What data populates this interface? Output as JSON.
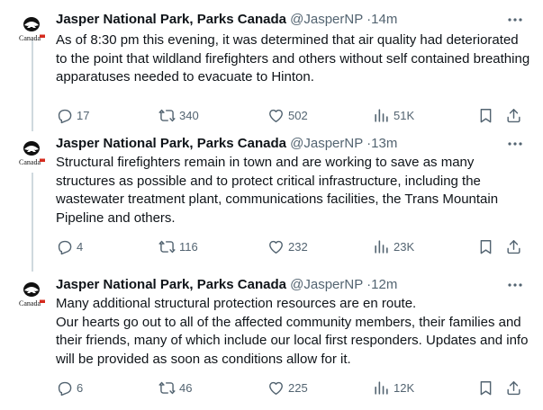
{
  "thread": [
    {
      "author": {
        "name": "Jasper National Park, Parks Canada",
        "handle": "@JasperNP",
        "time": "14m",
        "avatar_label": "Canada"
      },
      "text": [
        "As of  8:30 pm this evening, it was determined that air quality had deteriorated to the point that wildland firefighters and others without self contained breathing apparatuses needed to evacuate to Hinton."
      ],
      "stats": {
        "replies": "17",
        "reposts": "340",
        "likes": "502",
        "views": "51K"
      }
    },
    {
      "author": {
        "name": "Jasper National Park, Parks Canada",
        "handle": "@JasperNP",
        "time": "13m",
        "avatar_label": "Canada"
      },
      "text": [
        "Structural firefighters remain in town and are working to save as many structures as possible and to protect critical infrastructure, including the wastewater treatment plant, communications facilities, the Trans Mountain Pipeline and others."
      ],
      "stats": {
        "replies": "4",
        "reposts": "116",
        "likes": "232",
        "views": "23K"
      }
    },
    {
      "author": {
        "name": "Jasper National Park, Parks Canada",
        "handle": "@JasperNP",
        "time": "12m",
        "avatar_label": "Canada"
      },
      "text": [
        "Many additional structural protection resources are en route.",
        "Our hearts go out to all of the affected community members, their families and their friends, many of which include our local first responders. Updates and info will be provided as soon as conditions allow for it."
      ],
      "stats": {
        "replies": "6",
        "reposts": "46",
        "likes": "225",
        "views": "12K"
      }
    }
  ],
  "colors": {
    "text": "#0f1419",
    "muted": "#536471",
    "thread_line": "#cfd9de",
    "flag_red": "#d52b1e"
  },
  "icons": [
    "more-icon",
    "reply-icon",
    "repost-icon",
    "like-icon",
    "views-icon",
    "bookmark-icon",
    "share-icon"
  ]
}
